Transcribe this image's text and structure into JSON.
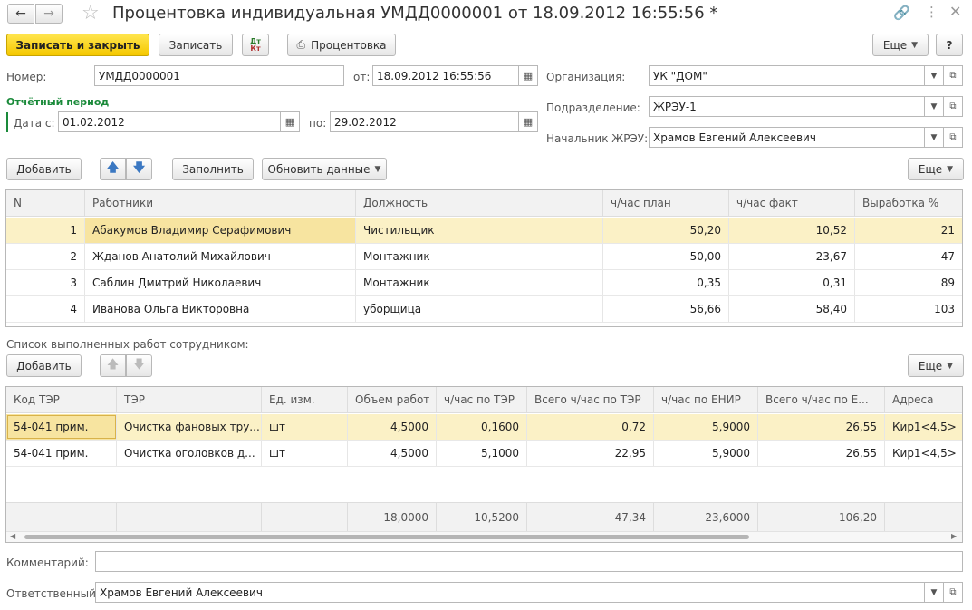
{
  "window": {
    "title": "Процентовка индивидуальная УМДД0000001 от 18.09.2012 16:55:56 *"
  },
  "toolbar": {
    "save_close": "Записать и закрыть",
    "save": "Записать",
    "dt_kt_top": "Дт",
    "dt_kt_bottom": "Кт",
    "print": "Процентовка",
    "more": "Еще",
    "help": "?"
  },
  "header": {
    "number_label": "Номер:",
    "number_value": "УМДД0000001",
    "from_label": "от:",
    "from_value": "18.09.2012 16:55:56",
    "period_title": "Отчётный период",
    "date_from_label": "Дата с:",
    "date_from_value": "01.02.2012",
    "date_to_label": "по:",
    "date_to_value": "29.02.2012",
    "org_label": "Организация:",
    "org_value": "УК \"ДОМ\"",
    "dept_label": "Подразделение:",
    "dept_value": "ЖРЭУ-1",
    "chief_label": "Начальник ЖРЭУ:",
    "chief_value": "Храмов Евгений Алексеевич"
  },
  "workers_toolbar": {
    "add": "Добавить",
    "fill": "Заполнить",
    "refresh": "Обновить данные",
    "more": "Еще"
  },
  "workers": {
    "columns": [
      "N",
      "Работники",
      "Должность",
      "ч/час план",
      "ч/час факт",
      "Выработка %"
    ],
    "rows": [
      {
        "n": "1",
        "name": "Абакумов Владимир Серафимович",
        "position": "Чистильщик",
        "plan": "50,20",
        "fact": "10,52",
        "output": "21"
      },
      {
        "n": "2",
        "name": "Жданов Анатолий Михайлович",
        "position": "Монтажник",
        "plan": "50,00",
        "fact": "23,67",
        "output": "47"
      },
      {
        "n": "3",
        "name": "Саблин Дмитрий Николаевич",
        "position": "Монтажник",
        "plan": "0,35",
        "fact": "0,31",
        "output": "89"
      },
      {
        "n": "4",
        "name": "Иванова Ольга Викторовна",
        "position": "уборщица",
        "plan": "56,66",
        "fact": "58,40",
        "output": "103"
      }
    ]
  },
  "works": {
    "caption": "Список выполненных работ сотрудником:",
    "add": "Добавить",
    "more": "Еще",
    "columns": [
      "Код ТЭР",
      "ТЭР",
      "Ед. изм.",
      "Объем работ",
      "ч/час по ТЭР",
      "Всего ч/час по ТЭР",
      "ч/час по ЕНИР",
      "Всего ч/час по Е...",
      "Адреса"
    ],
    "rows": [
      {
        "code": "54-041 прим.",
        "ter": "Очистка фановых тру...",
        "unit": "шт",
        "volume": "4,5000",
        "hour_ter": "0,1600",
        "total_ter": "0,72",
        "hour_enir": "5,9000",
        "total_enir": "26,55",
        "address": "Кир1<4,5>"
      },
      {
        "code": "54-041 прим.",
        "ter": "Очистка оголовков д...",
        "unit": "шт",
        "volume": "4,5000",
        "hour_ter": "5,1000",
        "total_ter": "22,95",
        "hour_enir": "5,9000",
        "total_enir": "26,55",
        "address": "Кир1<4,5>"
      }
    ],
    "totals": {
      "volume": "18,0000",
      "hour_ter": "10,5200",
      "total_ter": "47,34",
      "hour_enir": "23,6000",
      "total_enir": "106,20"
    }
  },
  "footer": {
    "comment_label": "Комментарий:",
    "comment_value": "",
    "responsible_label": "Ответственный:",
    "responsible_value": "Храмов Евгений Алексеевич"
  }
}
